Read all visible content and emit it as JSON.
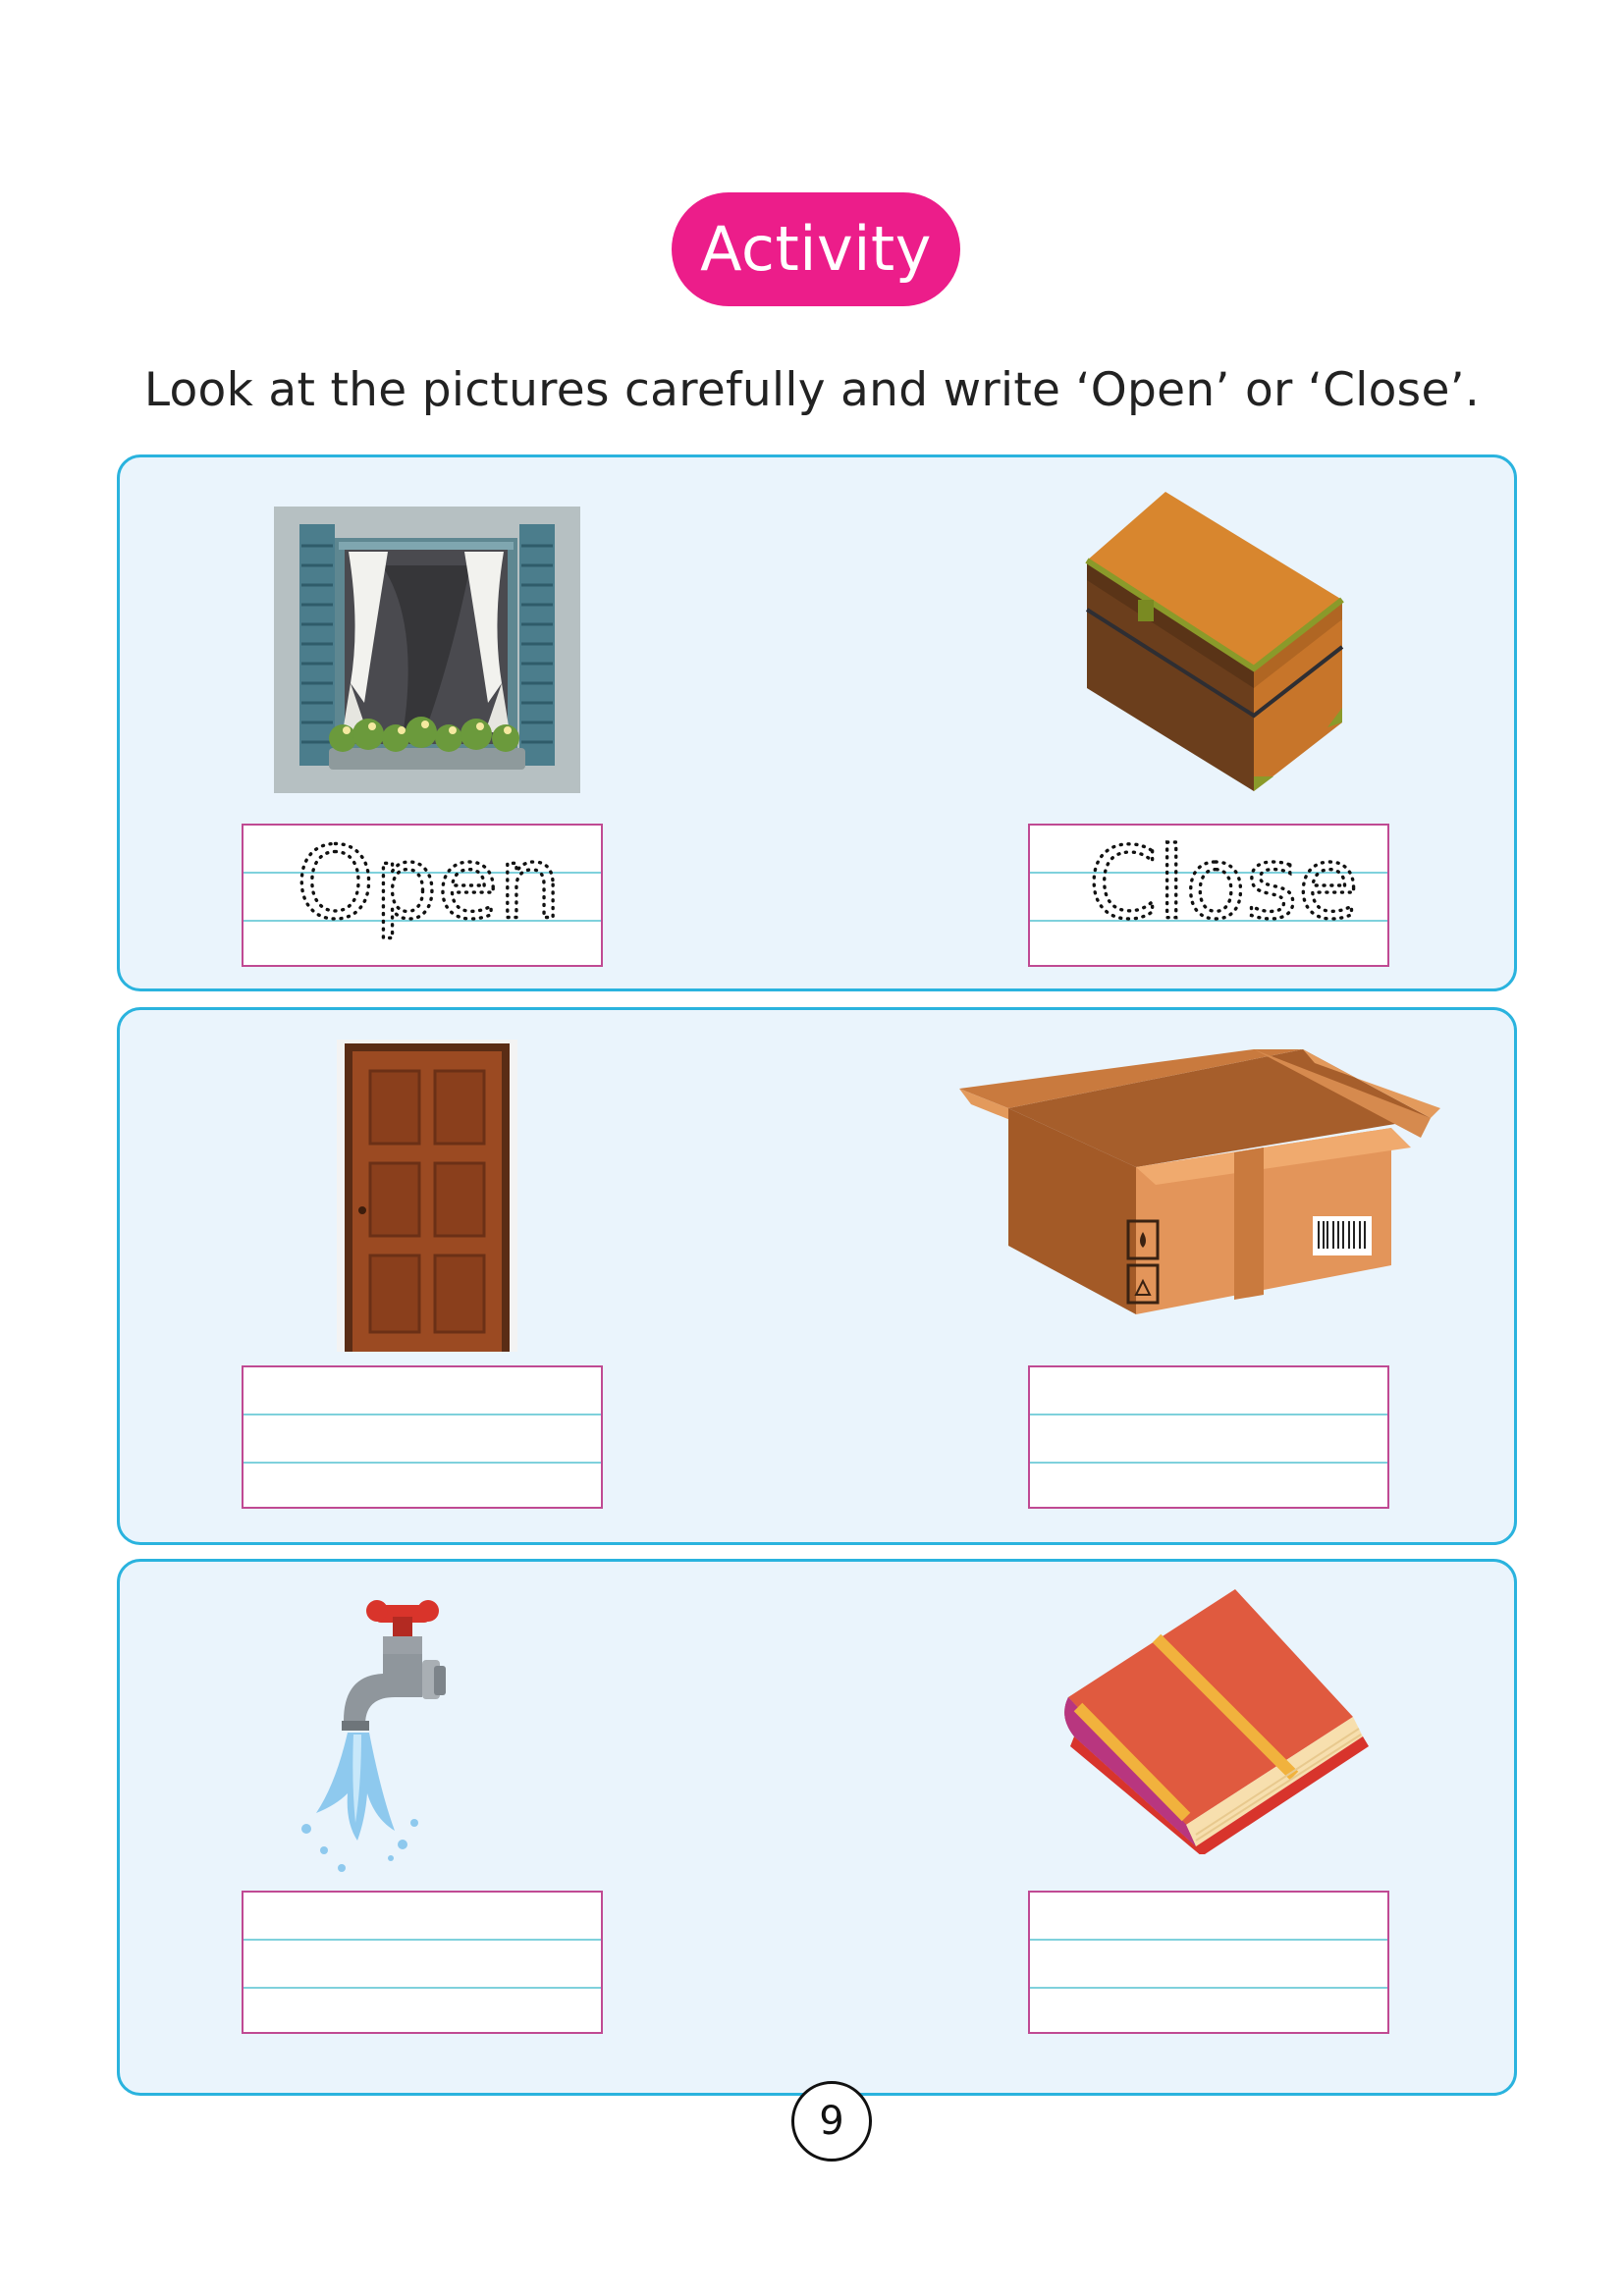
{
  "header": {
    "badge_label": "Activity"
  },
  "instruction": "Look at the pictures carefully and write ‘Open’ or ‘Close’.",
  "items": [
    {
      "name": "window",
      "answer": "Open",
      "answer_state": "traced"
    },
    {
      "name": "chest",
      "answer": "Close",
      "answer_state": "traced"
    },
    {
      "name": "door",
      "answer": "",
      "answer_state": "blank"
    },
    {
      "name": "cardboard-box",
      "answer": "",
      "answer_state": "blank"
    },
    {
      "name": "tap",
      "answer": "",
      "answer_state": "blank"
    },
    {
      "name": "book",
      "answer": "",
      "answer_state": "blank"
    }
  ],
  "colors": {
    "accent": "#ec1d8a",
    "panel_border": "#2ab3de",
    "panel_fill": "#eaf4fc",
    "box_border": "#c04a93"
  },
  "footer": {
    "page_number": "9"
  }
}
